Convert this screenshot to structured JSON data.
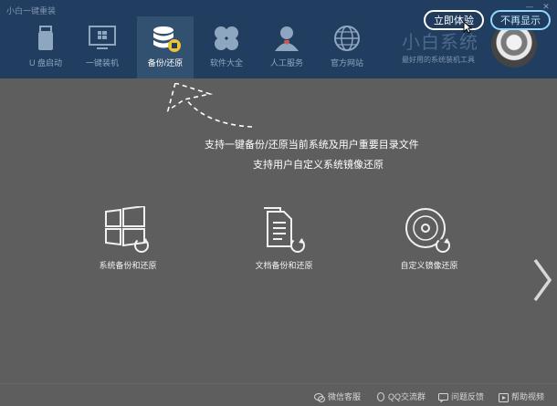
{
  "window": {
    "title": "小白一键重装",
    "minimize_glyph": "—",
    "close_glyph": "✕"
  },
  "nav": {
    "items": [
      {
        "label": "U 盘启动",
        "icon": "usb-drive-icon"
      },
      {
        "label": "一键装机",
        "icon": "monitor-windows-icon"
      },
      {
        "label": "备份/还原",
        "icon": "database-backup-icon",
        "active": true
      },
      {
        "label": "软件大全",
        "icon": "clover-apps-icon"
      },
      {
        "label": "人工服务",
        "icon": "support-agent-icon"
      },
      {
        "label": "官方网站",
        "icon": "globe-icon"
      }
    ]
  },
  "brand": {
    "name": "小白系统",
    "tagline": "最好用的系统装机工具"
  },
  "overlay": {
    "start_button": "立即体验",
    "dismiss_button": "不再显示",
    "hint_line1": "支持一键备份/还原当前系统及用户重要目录文件",
    "hint_line2": "支持用户自定义系统镜像还原"
  },
  "features": [
    {
      "label": "系统备份和还原",
      "icon": "windows-restore-icon"
    },
    {
      "label": "文档备份和还原",
      "icon": "document-restore-icon"
    },
    {
      "label": "自定义镜像还原",
      "icon": "disc-restore-icon"
    }
  ],
  "footer": {
    "items": [
      {
        "label": "微信客服",
        "icon": "wechat-icon"
      },
      {
        "label": "QQ交流群",
        "icon": "qq-icon"
      },
      {
        "label": "问题反馈",
        "icon": "feedback-icon"
      },
      {
        "label": "帮助视频",
        "icon": "help-video-icon"
      }
    ]
  },
  "colors": {
    "header_bg": "#213d5f",
    "active_tab_bg": "#32506f",
    "overlay_gray": "#5e5e5e",
    "dismiss_border": "#8fd8ff"
  }
}
